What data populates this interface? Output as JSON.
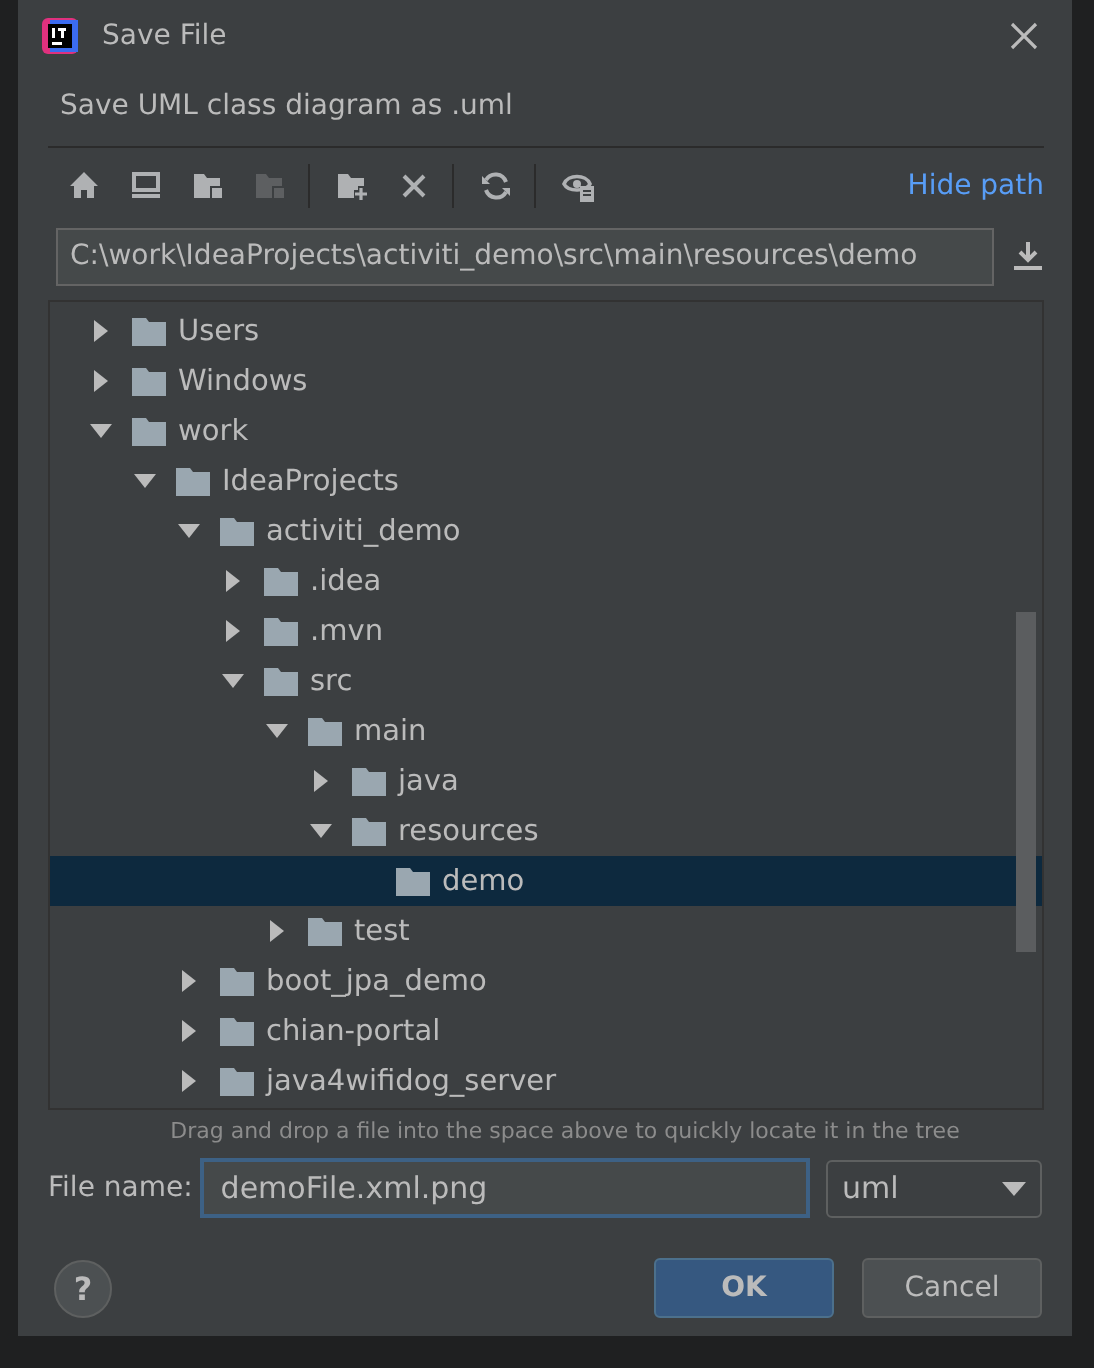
{
  "window": {
    "title": "Save File"
  },
  "description": "Save UML class diagram as .uml",
  "toolbar": [
    {
      "kind": "home",
      "disabled": false
    },
    {
      "kind": "desktop",
      "disabled": false
    },
    {
      "kind": "project",
      "disabled": false
    },
    {
      "kind": "module",
      "disabled": true
    },
    {
      "kind": "new-folder",
      "disabled": false
    },
    {
      "kind": "delete",
      "disabled": false
    },
    {
      "kind": "refresh",
      "disabled": false
    },
    {
      "kind": "show-hidden",
      "disabled": false
    }
  ],
  "hide_path_link": "Hide path",
  "path_field": {
    "value": "C:\\work\\IdeaProjects\\activiti_demo\\src\\main\\resources\\demo"
  },
  "tree": [
    {
      "label": "Users",
      "expanded": false,
      "selected": false
    },
    {
      "label": "Windows",
      "expanded": false,
      "selected": false
    },
    {
      "label": "work",
      "expanded": true,
      "selected": false,
      "children": [
        {
          "label": "IdeaProjects",
          "expanded": true,
          "selected": false,
          "children": [
            {
              "label": "activiti_demo",
              "expanded": true,
              "selected": false,
              "children": [
                {
                  "label": ".idea",
                  "expanded": false,
                  "selected": false
                },
                {
                  "label": ".mvn",
                  "expanded": false,
                  "selected": false
                },
                {
                  "label": "src",
                  "expanded": true,
                  "selected": false,
                  "children": [
                    {
                      "label": "main",
                      "expanded": true,
                      "selected": false,
                      "children": [
                        {
                          "label": "java",
                          "expanded": false,
                          "selected": false
                        },
                        {
                          "label": "resources",
                          "expanded": true,
                          "selected": false,
                          "children": [
                            {
                              "label": "demo",
                              "selected": true
                            }
                          ]
                        }
                      ]
                    },
                    {
                      "label": "test",
                      "expanded": false,
                      "selected": false
                    }
                  ]
                }
              ]
            },
            {
              "label": "boot_jpa_demo",
              "expanded": false,
              "selected": false
            },
            {
              "label": "chian-portal",
              "expanded": false,
              "selected": false
            },
            {
              "label": "java4wifidog_server",
              "expanded": false,
              "selected": false
            }
          ]
        }
      ]
    }
  ],
  "hint": "Drag and drop a file into the space above to quickly locate it in the tree",
  "file_name": {
    "label": "File name:",
    "value": "demoFile.xml.png"
  },
  "file_type": {
    "value": "uml"
  },
  "help_button": "?",
  "buttons": [
    {
      "label": "OK",
      "kind": "default"
    },
    {
      "label": "Cancel",
      "kind": "normal"
    }
  ]
}
